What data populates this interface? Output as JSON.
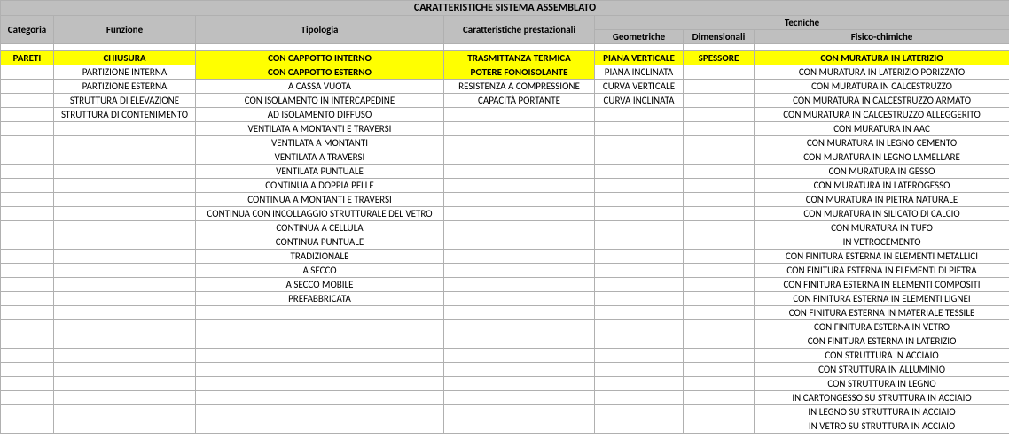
{
  "title": "CARATTERISTICHE SISTEMA ASSEMBLATO",
  "headers": {
    "categoria": "Categoria",
    "funzione": "Funzione",
    "tipologia": "Tipologia",
    "caratteristiche": "Caratteristiche prestazionali",
    "tecniche": "Tecniche",
    "geometriche": "Geometriche",
    "dimensionali": "Dimensionali",
    "fisicoChimiche": "Fisico-chimiche"
  },
  "chart_data": {
    "type": "table",
    "columns": [
      "Categoria",
      "Funzione",
      "Tipologia",
      "Caratteristiche prestazionali",
      "Geometriche",
      "Dimensionali",
      "Fisico-chimiche"
    ],
    "highlighted_row_index": 0,
    "highlighted_cells_row_1": [
      "Tipologia",
      "Caratteristiche prestazionali"
    ],
    "rows": [
      {
        "categoria": "PARETI",
        "funzione": "CHIUSURA",
        "tipologia": "CON CAPPOTTO INTERNO",
        "caratteristiche": "TRASMITTANZA TERMICA",
        "geometriche": "PIANA VERTICALE",
        "dimensionali": "SPESSORE",
        "fisicoChimiche": "CON MURATURA IN LATERIZIO"
      },
      {
        "categoria": "",
        "funzione": "PARTIZIONE INTERNA",
        "tipologia": "CON CAPPOTTO ESTERNO",
        "caratteristiche": "POTERE FONOISOLANTE",
        "geometriche": "PIANA INCLINATA",
        "dimensionali": "",
        "fisicoChimiche": "CON MURATURA IN LATERIZIO PORIZZATO"
      },
      {
        "categoria": "",
        "funzione": "PARTIZIONE ESTERNA",
        "tipologia": "A CASSA VUOTA",
        "caratteristiche": "RESISTENZA A COMPRESSIONE",
        "geometriche": "CURVA VERTICALE",
        "dimensionali": "",
        "fisicoChimiche": "CON MURATURA IN CALCESTRUZZO"
      },
      {
        "categoria": "",
        "funzione": "STRUTTURA DI ELEVAZIONE",
        "tipologia": "CON ISOLAMENTO IN INTERCAPEDINE",
        "caratteristiche": "CAPACITÀ PORTANTE",
        "geometriche": "CURVA INCLINATA",
        "dimensionali": "",
        "fisicoChimiche": "CON MURATURA IN CALCESTRUZZO ARMATO"
      },
      {
        "categoria": "",
        "funzione": "STRUTTURA DI CONTENIMENTO",
        "tipologia": "AD ISOLAMENTO DIFFUSO",
        "caratteristiche": "",
        "geometriche": "",
        "dimensionali": "",
        "fisicoChimiche": "CON MURATURA IN CALCESTRUZZO ALLEGGERITO"
      },
      {
        "categoria": "",
        "funzione": "",
        "tipologia": "VENTILATA A MONTANTI E TRAVERSI",
        "caratteristiche": "",
        "geometriche": "",
        "dimensionali": "",
        "fisicoChimiche": "CON MURATURA IN AAC"
      },
      {
        "categoria": "",
        "funzione": "",
        "tipologia": "VENTILATA A MONTANTI",
        "caratteristiche": "",
        "geometriche": "",
        "dimensionali": "",
        "fisicoChimiche": "CON MURATURA IN LEGNO CEMENTO"
      },
      {
        "categoria": "",
        "funzione": "",
        "tipologia": "VENTILATA A TRAVERSI",
        "caratteristiche": "",
        "geometriche": "",
        "dimensionali": "",
        "fisicoChimiche": "CON MURATURA IN LEGNO LAMELLARE"
      },
      {
        "categoria": "",
        "funzione": "",
        "tipologia": "VENTILATA PUNTUALE",
        "caratteristiche": "",
        "geometriche": "",
        "dimensionali": "",
        "fisicoChimiche": "CON MURATURA IN GESSO"
      },
      {
        "categoria": "",
        "funzione": "",
        "tipologia": "CONTINUA A DOPPIA PELLE",
        "caratteristiche": "",
        "geometriche": "",
        "dimensionali": "",
        "fisicoChimiche": "CON MURATURA IN LATEROGESSO"
      },
      {
        "categoria": "",
        "funzione": "",
        "tipologia": "CONTINUA A MONTANTI E TRAVERSI",
        "caratteristiche": "",
        "geometriche": "",
        "dimensionali": "",
        "fisicoChimiche": "CON MURATURA IN PIETRA NATURALE"
      },
      {
        "categoria": "",
        "funzione": "",
        "tipologia": "CONTINUA CON INCOLLAGGIO STRUTTURALE DEL VETRO",
        "caratteristiche": "",
        "geometriche": "",
        "dimensionali": "",
        "fisicoChimiche": "CON MURATURA IN SILICATO DI CALCIO"
      },
      {
        "categoria": "",
        "funzione": "",
        "tipologia": "CONTINUA A CELLULA",
        "caratteristiche": "",
        "geometriche": "",
        "dimensionali": "",
        "fisicoChimiche": "CON MURATURA IN TUFO"
      },
      {
        "categoria": "",
        "funzione": "",
        "tipologia": "CONTINUA PUNTUALE",
        "caratteristiche": "",
        "geometriche": "",
        "dimensionali": "",
        "fisicoChimiche": "IN VETROCEMENTO"
      },
      {
        "categoria": "",
        "funzione": "",
        "tipologia": "TRADIZIONALE",
        "caratteristiche": "",
        "geometriche": "",
        "dimensionali": "",
        "fisicoChimiche": "CON FINITURA ESTERNA IN ELEMENTI METALLICI"
      },
      {
        "categoria": "",
        "funzione": "",
        "tipologia": "A SECCO",
        "caratteristiche": "",
        "geometriche": "",
        "dimensionali": "",
        "fisicoChimiche": "CON FINITURA ESTERNA IN ELEMENTI DI PIETRA"
      },
      {
        "categoria": "",
        "funzione": "",
        "tipologia": "A SECCO MOBILE",
        "caratteristiche": "",
        "geometriche": "",
        "dimensionali": "",
        "fisicoChimiche": "CON FINITURA ESTERNA IN ELEMENTI COMPOSITI"
      },
      {
        "categoria": "",
        "funzione": "",
        "tipologia": "PREFABBRICATA",
        "caratteristiche": "",
        "geometriche": "",
        "dimensionali": "",
        "fisicoChimiche": "CON FINITURA ESTERNA IN ELEMENTI LIGNEI"
      },
      {
        "categoria": "",
        "funzione": "",
        "tipologia": "",
        "caratteristiche": "",
        "geometriche": "",
        "dimensionali": "",
        "fisicoChimiche": "CON FINITURA ESTERNA IN MATERIALE TESSILE"
      },
      {
        "categoria": "",
        "funzione": "",
        "tipologia": "",
        "caratteristiche": "",
        "geometriche": "",
        "dimensionali": "",
        "fisicoChimiche": "CON FINITURA ESTERNA IN VETRO"
      },
      {
        "categoria": "",
        "funzione": "",
        "tipologia": "",
        "caratteristiche": "",
        "geometriche": "",
        "dimensionali": "",
        "fisicoChimiche": "CON FINITURA ESTERNA IN LATERIZIO"
      },
      {
        "categoria": "",
        "funzione": "",
        "tipologia": "",
        "caratteristiche": "",
        "geometriche": "",
        "dimensionali": "",
        "fisicoChimiche": "CON STRUTTURA IN ACCIAIO"
      },
      {
        "categoria": "",
        "funzione": "",
        "tipologia": "",
        "caratteristiche": "",
        "geometriche": "",
        "dimensionali": "",
        "fisicoChimiche": "CON STRUTTURA IN ALLUMINIO"
      },
      {
        "categoria": "",
        "funzione": "",
        "tipologia": "",
        "caratteristiche": "",
        "geometriche": "",
        "dimensionali": "",
        "fisicoChimiche": "CON STRUTTURA IN LEGNO"
      },
      {
        "categoria": "",
        "funzione": "",
        "tipologia": "",
        "caratteristiche": "",
        "geometriche": "",
        "dimensionali": "",
        "fisicoChimiche": "IN CARTONGESSO SU STRUTTURA IN ACCIAIO"
      },
      {
        "categoria": "",
        "funzione": "",
        "tipologia": "",
        "caratteristiche": "",
        "geometriche": "",
        "dimensionali": "",
        "fisicoChimiche": "IN LEGNO SU STRUTTURA IN ACCIAIO"
      },
      {
        "categoria": "",
        "funzione": "",
        "tipologia": "",
        "caratteristiche": "",
        "geometriche": "",
        "dimensionali": "",
        "fisicoChimiche": "IN VETRO SU STRUTTURA IN ACCIAIO"
      }
    ]
  }
}
